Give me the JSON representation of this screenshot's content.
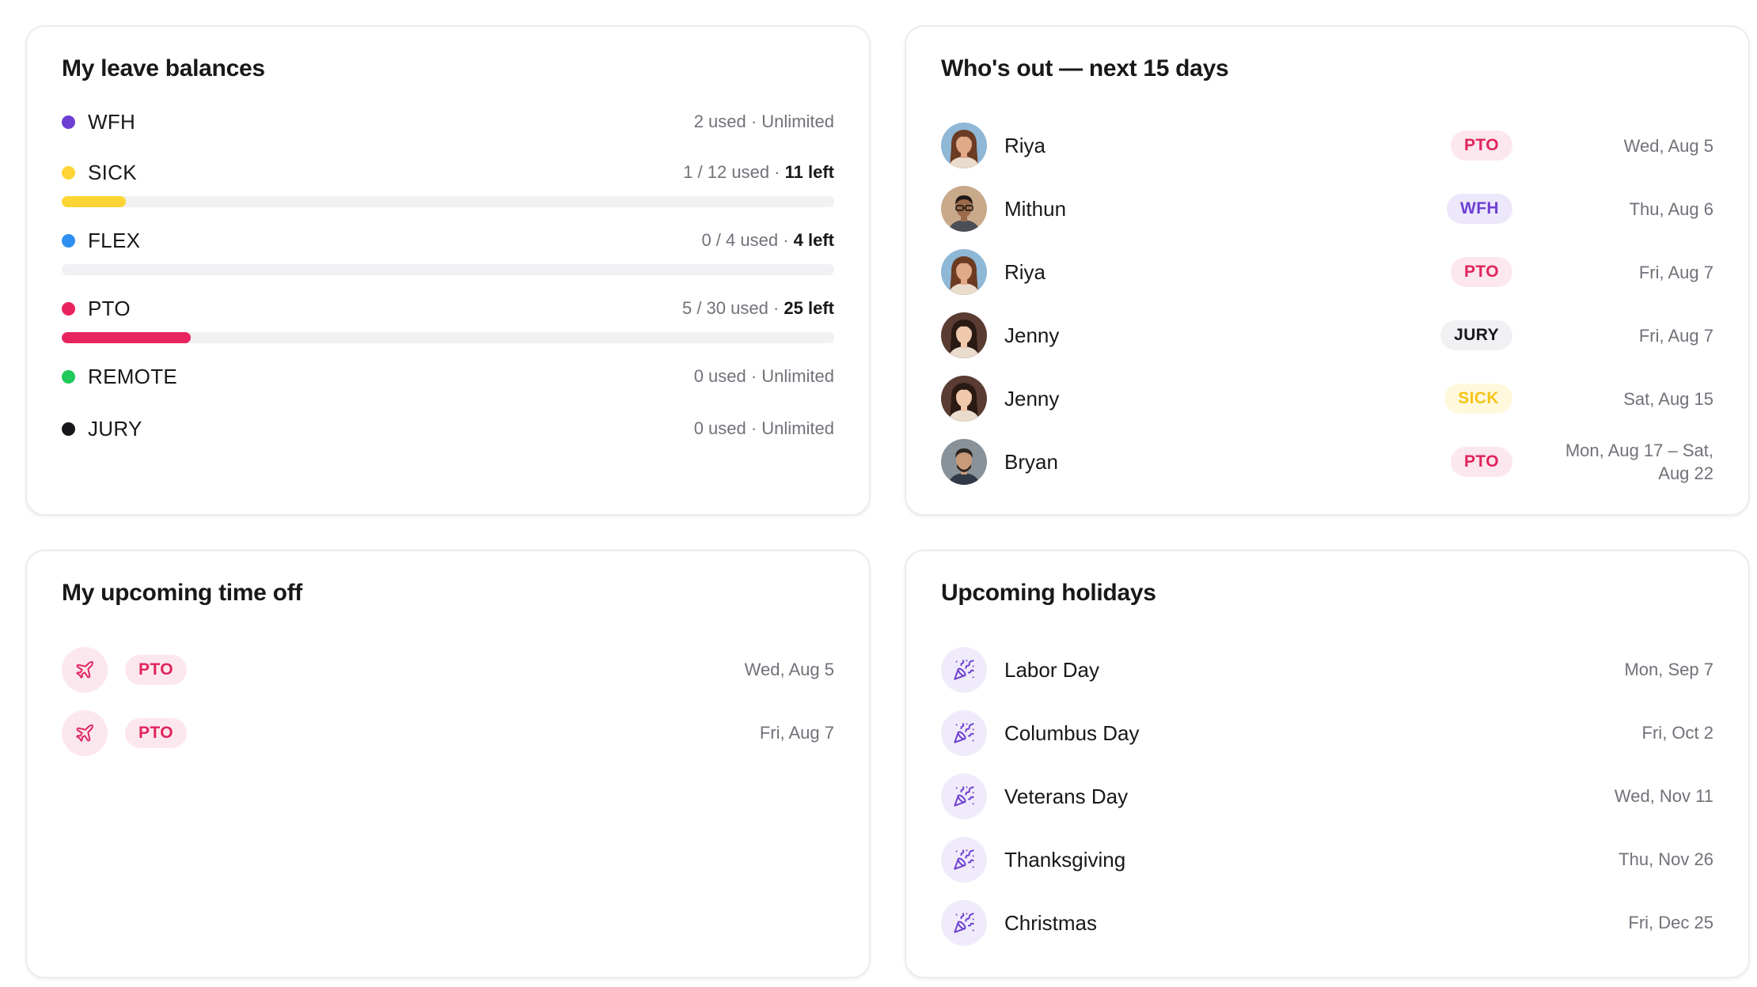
{
  "balances": {
    "title": "My leave balances",
    "items": [
      {
        "name": "WFH",
        "usage": "2 used · Unlimited",
        "left": "",
        "color": "#6d3fd3",
        "bar": false
      },
      {
        "name": "SICK",
        "usage": "1 / 12 used · ",
        "left": "11 left",
        "color": "#fcd535",
        "bar": true,
        "fraction": 0.083
      },
      {
        "name": "FLEX",
        "usage": "0 / 4 used · ",
        "left": "4 left",
        "color": "#2e8ff0",
        "bar": true,
        "fraction": 0.0
      },
      {
        "name": "PTO",
        "usage": "5 / 30 used · ",
        "left": "25 left",
        "color": "#e8245e",
        "bar": true,
        "fraction": 0.167
      },
      {
        "name": "REMOTE",
        "usage": "0 used · Unlimited",
        "left": "",
        "color": "#1fc95a",
        "bar": false
      },
      {
        "name": "JURY",
        "usage": "0 used · Unlimited",
        "left": "",
        "color": "#18181b",
        "bar": false
      }
    ]
  },
  "whos_out": {
    "title": "Who's out — next 15 days",
    "items": [
      {
        "name": "Riya",
        "badge": "PTO",
        "date": "Wed, Aug 5"
      },
      {
        "name": "Mithun",
        "badge": "WFH",
        "date": "Thu, Aug 6"
      },
      {
        "name": "Riya",
        "badge": "PTO",
        "date": "Fri, Aug 7"
      },
      {
        "name": "Jenny",
        "badge": "JURY",
        "date": "Fri, Aug 7"
      },
      {
        "name": "Jenny",
        "badge": "SICK",
        "date": "Sat, Aug 15"
      },
      {
        "name": "Bryan",
        "badge": "PTO",
        "date": "Mon, Aug 17 – Sat, Aug 22"
      }
    ]
  },
  "badge_colors": {
    "PTO": {
      "bg": "#fde7ee",
      "fg": "#e0245e"
    },
    "WFH": {
      "bg": "#ece7fb",
      "fg": "#6d3fd3"
    },
    "JURY": {
      "bg": "#f1f1f4",
      "fg": "#18181b"
    },
    "SICK": {
      "bg": "#fff8dc",
      "fg": "#f5c518"
    }
  },
  "time_off": {
    "title": "My upcoming time off",
    "items": [
      {
        "badge": "PTO",
        "date": "Wed, Aug 5",
        "icon": "airplane-icon"
      },
      {
        "badge": "PTO",
        "date": "Fri, Aug 7",
        "icon": "airplane-icon"
      }
    ]
  },
  "holidays": {
    "title": "Upcoming holidays",
    "items": [
      {
        "name": "Labor Day",
        "date": "Mon, Sep 7",
        "icon": "party-popper-icon"
      },
      {
        "name": "Columbus Day",
        "date": "Fri, Oct 2",
        "icon": "party-popper-icon"
      },
      {
        "name": "Veterans Day",
        "date": "Wed, Nov 11",
        "icon": "party-popper-icon"
      },
      {
        "name": "Thanksgiving",
        "date": "Thu, Nov 26",
        "icon": "party-popper-icon"
      },
      {
        "name": "Christmas",
        "date": "Fri, Dec 25",
        "icon": "party-popper-icon"
      }
    ]
  }
}
